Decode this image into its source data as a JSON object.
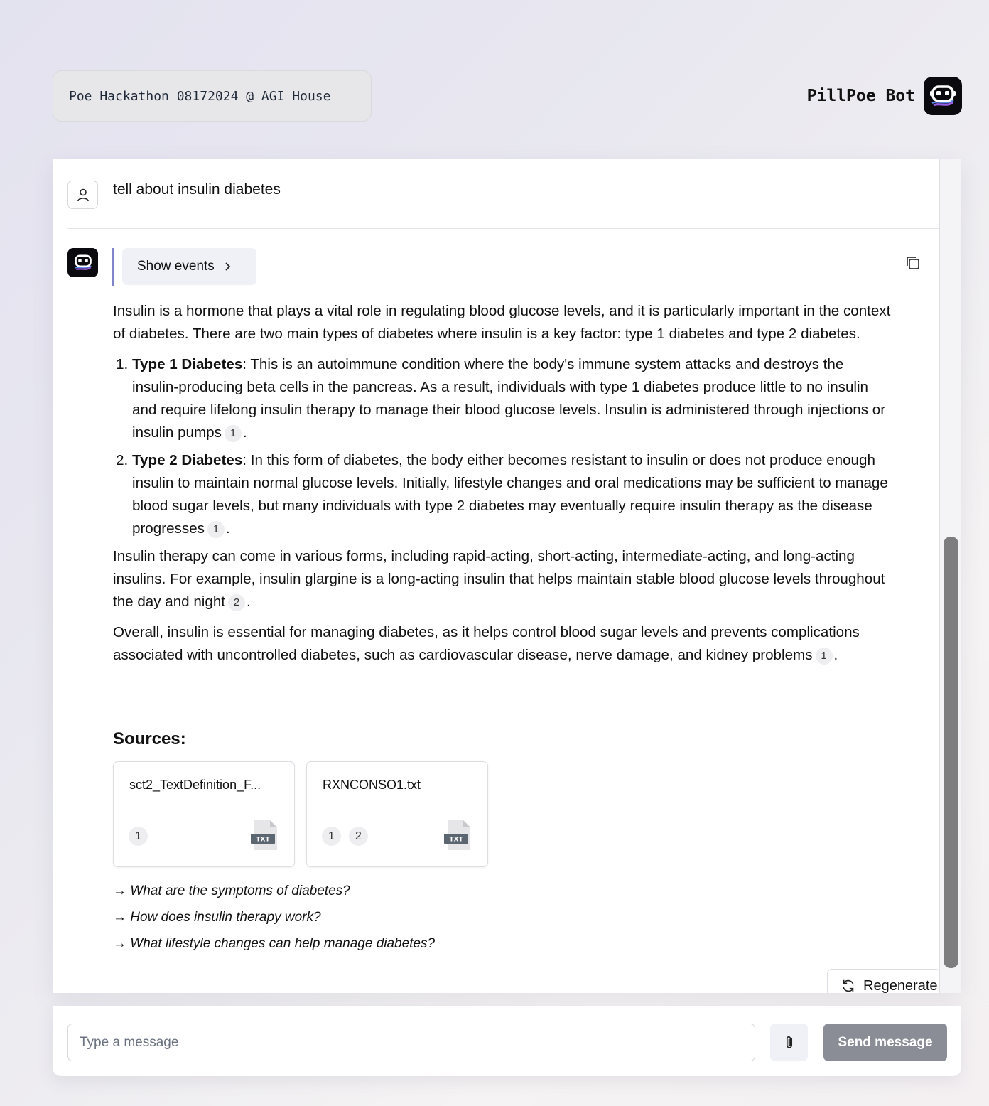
{
  "header": {
    "event_label": "Poe Hackathon 08172024 @ AGI House",
    "bot_name": "PillPoe Bot",
    "bot_logo_icon": "robot-chat-icon"
  },
  "user_message": {
    "avatar_icon": "user-icon",
    "text": "tell about insulin diabetes"
  },
  "bot_message": {
    "avatar_icon": "robot-chat-icon",
    "show_events_label": "Show events",
    "paragraph_1": "Insulin is a hormone that plays a vital role in regulating blood glucose levels, and it is particularly important in the context of diabetes. There are two main types of diabetes where insulin is a key factor: type 1 diabetes and type 2 diabetes.",
    "list": [
      {
        "title": "Type 1 Diabetes",
        "text": ": This is an autoimmune condition where the body's immune system attacks and destroys the insulin-producing beta cells in the pancreas. As a result, individuals with type 1 diabetes produce little to no insulin and require lifelong insulin therapy to manage their blood glucose levels. Insulin is administered through injections or insulin pumps",
        "cite": "1"
      },
      {
        "title": "Type 2 Diabetes",
        "text": ": In this form of diabetes, the body either becomes resistant to insulin or does not produce enough insulin to maintain normal glucose levels. Initially, lifestyle changes and oral medications may be sufficient to manage blood sugar levels, but many individuals with type 2 diabetes may eventually require insulin therapy as the disease progresses",
        "cite": "1"
      }
    ],
    "paragraph_2": "Insulin therapy can come in various forms, including rapid-acting, short-acting, intermediate-acting, and long-acting insulins. For example, insulin glargine is a long-acting insulin that helps maintain stable blood glucose levels throughout the day and night",
    "paragraph_2_cite": "2",
    "paragraph_3": "Overall, insulin is essential for managing diabetes, as it helps control blood sugar levels and prevents complications associated with uncontrolled diabetes, such as cardiovascular disease, nerve damage, and kidney problems",
    "paragraph_3_cite": "1",
    "period": ".",
    "sources_title": "Sources:",
    "sources": [
      {
        "name": "sct2_TextDefinition_F...",
        "cites": [
          "1"
        ],
        "file_type": "TXT"
      },
      {
        "name": "RXNCONSO1.txt",
        "cites": [
          "1",
          "2"
        ],
        "file_type": "TXT"
      }
    ],
    "followups": [
      "→ What are the symptoms of diabetes?",
      "→ How does insulin therapy work?",
      "→ What lifestyle changes can help manage diabetes?"
    ],
    "regenerate_label": "Regenerate"
  },
  "composer": {
    "placeholder": "Type a message",
    "value": "",
    "send_label": "Send message"
  },
  "colors": {
    "accent_bar": "#7f85c6",
    "send_button": "#8b8d96",
    "bot_logo_bg": "#0b0b0f"
  }
}
